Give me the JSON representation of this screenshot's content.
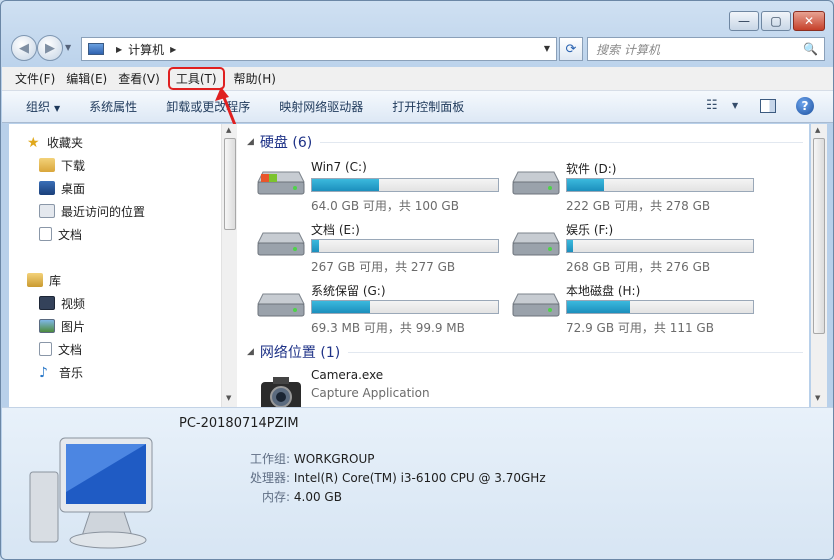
{
  "window": {
    "min": "—",
    "max": "▢",
    "close": "✕"
  },
  "nav": {
    "back": "◀",
    "forward": "▶",
    "refresh": "⟳"
  },
  "address": {
    "segment": "计算机"
  },
  "search": {
    "placeholder": "搜索 计算机",
    "icon": "🔍"
  },
  "menu": [
    "文件(F)",
    "编辑(E)",
    "查看(V)",
    "工具(T)",
    "帮助(H)"
  ],
  "toolbar": {
    "organize": "组织",
    "items": [
      "系统属性",
      "卸载或更改程序",
      "映射网络驱动器",
      "打开控制面板"
    ]
  },
  "sidebar": {
    "favorites": "收藏夹",
    "fav_items": [
      "下载",
      "桌面",
      "最近访问的位置",
      "文档"
    ],
    "library": "库",
    "lib_items": [
      "视频",
      "图片",
      "文档",
      "音乐"
    ]
  },
  "groups": {
    "hard_disks": "硬盘 (6)",
    "network": "网络位置 (1)"
  },
  "drives": [
    {
      "name": "Win7 (C:)",
      "info": "64.0 GB 可用，共 100 GB",
      "used_fraction": 0.36
    },
    {
      "name": "软件 (D:)",
      "info": "222 GB 可用，共 278 GB",
      "used_fraction": 0.2
    },
    {
      "name": "文档 (E:)",
      "info": "267 GB 可用，共 277 GB",
      "used_fraction": 0.04
    },
    {
      "name": "娱乐 (F:)",
      "info": "268 GB 可用，共 276 GB",
      "used_fraction": 0.03
    },
    {
      "name": "系统保留 (G:)",
      "info": "69.3 MB 可用，共 99.9 MB",
      "used_fraction": 0.31
    },
    {
      "name": "本地磁盘 (H:)",
      "info": "72.9 GB 可用，共 111 GB",
      "used_fraction": 0.34
    }
  ],
  "network_item": {
    "name": "Camera.exe",
    "desc": "Capture Application"
  },
  "details": {
    "pc_name": "PC-20180714PZIM",
    "workgroup_label": "工作组:",
    "workgroup": "WORKGROUP",
    "cpu_label": "处理器:",
    "cpu": "Intel(R) Core(TM) i3-6100 CPU @ 3.70GHz",
    "ram_label": "内存:",
    "ram": "4.00 GB"
  },
  "colors": {
    "bar_fill": "#26a4d0",
    "highlight": "#e02020"
  }
}
